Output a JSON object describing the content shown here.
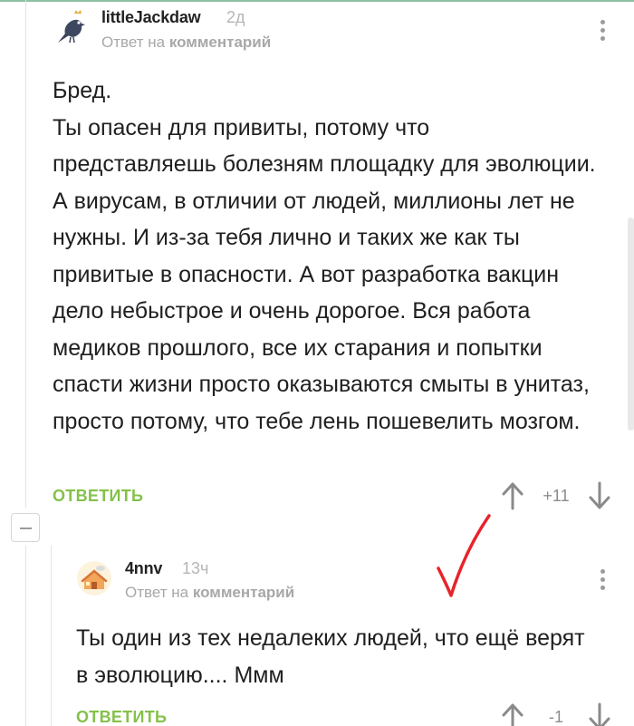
{
  "thread": {
    "comments": [
      {
        "author": "littleJackdaw",
        "time": "2д",
        "reply_prefix": "Ответ на",
        "reply_target": "комментарий",
        "text": "Бред.\nТы опасен для привиты, потому что представляешь болезням площадку для эволюции. А вирусам, в отличии от людей, миллионы лет не нужны. И из-за тебя лично и таких же как ты привитые в опасности. А вот разработка вакцин дело небыстрое и очень дорогое. Вся работа медиков прошлого, все их старания и попытки спасти жизни просто оказываются смыты в унитаз, просто потому, что тебе лень пошевелить мозгом.",
        "reply_label": "ОТВЕТИТЬ",
        "rating": "+11"
      },
      {
        "author": "4nnv",
        "time": "13ч",
        "reply_prefix": "Ответ на",
        "reply_target": "комментарий",
        "text": "Ты один из тех недалеких людей, что ещё верят в эволюцию.... Ммм",
        "reply_label": "ОТВЕТИТЬ",
        "rating": "-1"
      }
    ]
  },
  "icons": {
    "avatar_1": "jackdaw-bird-avatar",
    "avatar_2": "cartoon-house-avatar",
    "menu": "more-vertical-icon",
    "upvote": "arrow-up-icon",
    "downvote": "arrow-down-icon",
    "collapse": "minus-icon",
    "annotation": "red-checkmark"
  },
  "colors": {
    "accent_green": "#85c14a",
    "muted_gray": "#a8a8a8",
    "annotation_red": "#e8232a"
  }
}
